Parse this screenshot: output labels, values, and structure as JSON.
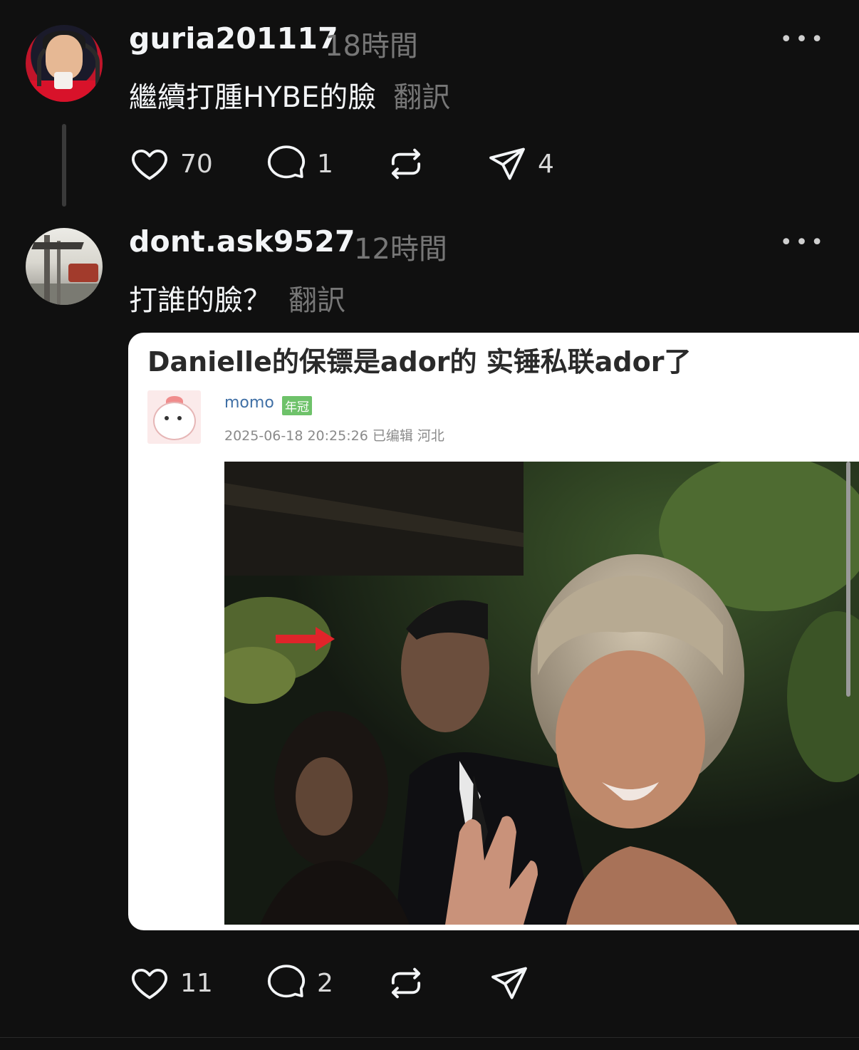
{
  "posts": [
    {
      "username": "guria201117",
      "time": "18時間",
      "text": "繼續打腫HYBE的臉",
      "translate_label": "翻訳",
      "likes": "70",
      "replies": "1",
      "shares": "4"
    },
    {
      "username": "dont.ask9527",
      "time": "12時間",
      "text": "打誰的臉？",
      "translate_label": "翻訳",
      "likes": "11",
      "replies": "2",
      "embed": {
        "title": "Danielle的保镖是ador的 实锤私联ador了",
        "author": "momo",
        "badge": "年冠",
        "meta": "2025-06-18 20:25:26 已编辑 河北"
      }
    }
  ],
  "more_label": "•••",
  "colors": {
    "background": "#101010",
    "text": "#f3f5f7",
    "muted": "#777777",
    "arrow": "#e0242a"
  }
}
